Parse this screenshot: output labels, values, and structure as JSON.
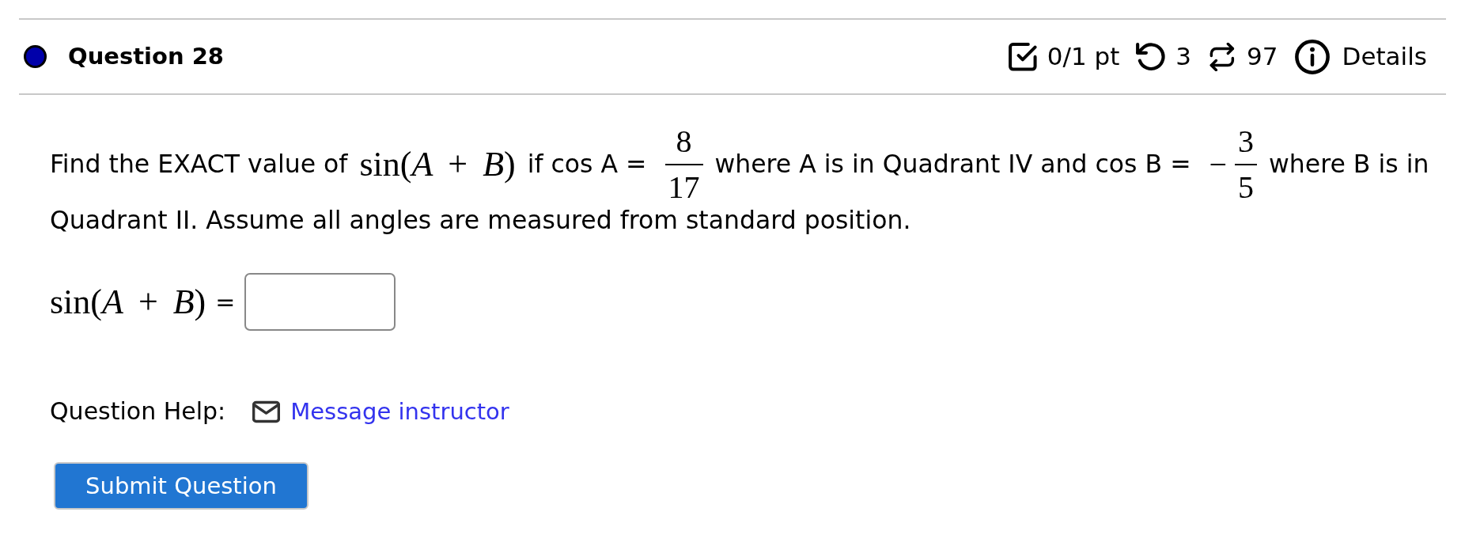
{
  "question": {
    "title": "Question 28",
    "meta": [
      {
        "kind": "score",
        "text": "0/1 pt"
      },
      {
        "kind": "retries",
        "text": "3"
      },
      {
        "kind": "attempts",
        "text": "97"
      },
      {
        "kind": "details",
        "text": "Details"
      }
    ]
  },
  "prompt": {
    "lines": [
      [
        {
          "kind": "text",
          "text": "Find the EXACT value of"
        },
        {
          "kind": "math",
          "text": "sin(*A* + *B*)"
        },
        {
          "kind": "text",
          "text": "if cos A ="
        },
        {
          "kind": "fraction",
          "numerator": "8",
          "denominator": "17"
        },
        {
          "kind": "text",
          "text": "where A is in Quadrant IV and cos B ="
        },
        {
          "kind": "fraction",
          "sign": "−",
          "numerator": "3",
          "denominator": "5"
        },
        {
          "kind": "text",
          "text": "where B is in"
        }
      ],
      [
        {
          "kind": "text",
          "text": "Quadrant II. Assume all angles are measured from standard position."
        }
      ]
    ]
  },
  "answer": {
    "label": [
      {
        "kind": "math",
        "text": "sin(*A* + *B*)"
      },
      {
        "kind": "text",
        "text": "="
      }
    ]
  },
  "help": {
    "label": "Question Help:",
    "link": "Message instructor"
  },
  "submit_button": {
    "label": "Submit Question"
  }
}
